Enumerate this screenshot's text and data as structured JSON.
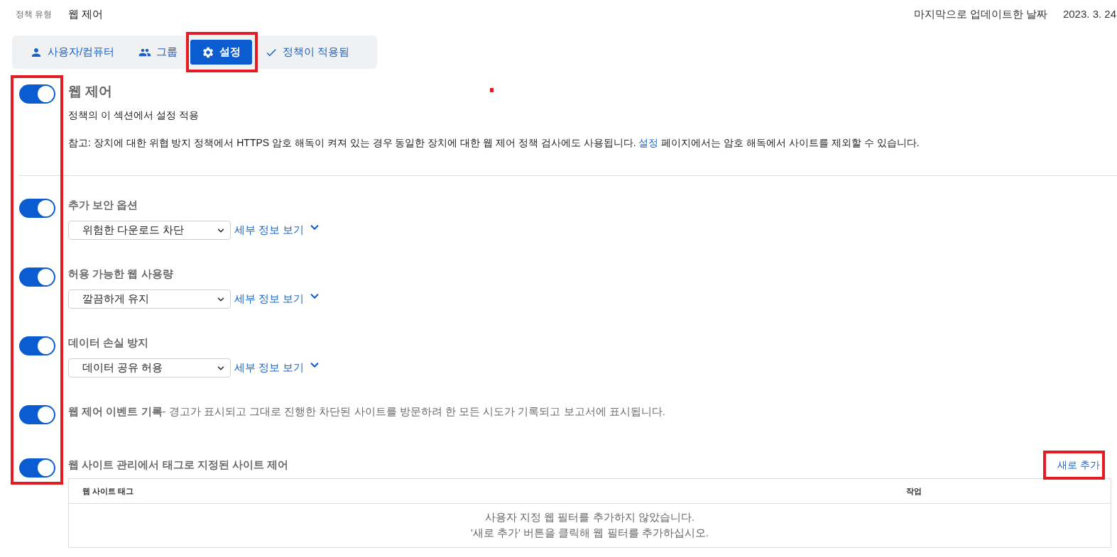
{
  "header": {
    "policy_type_label": "정책 유형",
    "policy_type": "웹 제어",
    "last_updated_label": "마지막으로 업데이트한 날짜",
    "last_updated": "2023. 3. 24"
  },
  "tabs": [
    {
      "kind": "users",
      "label": "사용자/컴퓨터",
      "selected": false,
      "highlighted": false
    },
    {
      "kind": "groups",
      "label": "그룹",
      "selected": false,
      "highlighted": false
    },
    {
      "kind": "settings",
      "label": "설정",
      "selected": true,
      "highlighted": true
    },
    {
      "kind": "applied",
      "label": "정책이 적용됨",
      "selected": false,
      "highlighted": false
    }
  ],
  "toggles_highlighted": true,
  "main": {
    "on": true,
    "title": "웹 제어",
    "subtitle": "정책의 이 섹션에서 설정 적용",
    "note": {
      "before": "참고: 장치에 대한 위협 방지 정책에서 HTTPS 암호 해독이 켜져 있는 경우 동일한 장치에 대한 웹 제어 정책 검사에도 사용됩니다.",
      "link": "설정",
      "after": "페이지에서는 암호 해독에서 사이트를 제외할 수 있습니다."
    }
  },
  "options": [
    {
      "kind": "select",
      "on": true,
      "title": "추가 보안 옵션",
      "value": "위험한 다운로드 차단",
      "link": "세부 정보 보기"
    },
    {
      "kind": "select",
      "on": true,
      "title": "허용 가능한 웹 사용량",
      "value": "깔끔하게 유지",
      "link": "세부 정보 보기"
    },
    {
      "kind": "select",
      "on": true,
      "title": "데이터 손실 방지",
      "value": "데이터 공유 허용",
      "link": "세부 정보 보기"
    },
    {
      "kind": "text",
      "on": true,
      "description": "**웹 제어 이벤트 기록**- 경고가 표시되고 그대로 진행한 차단된 사이트를 방문하려 한 모든 시도가 기록되고 보고서에 표시됩니다."
    },
    {
      "kind": "table",
      "on": true,
      "title": "웹 사이트 관리에서 태그로 지정된 사이트 제어",
      "action": {
        "label": "새로 추가",
        "highlighted": true
      },
      "columns": [
        "웹 사이트 태그",
        "작업"
      ],
      "empty_message": [
        "사용자 지정 웹 필터를 추가하지 않았습니다.",
        "'새로 추가' 버튼을 클릭해 웹 필터를 추가하십시오."
      ]
    }
  ]
}
